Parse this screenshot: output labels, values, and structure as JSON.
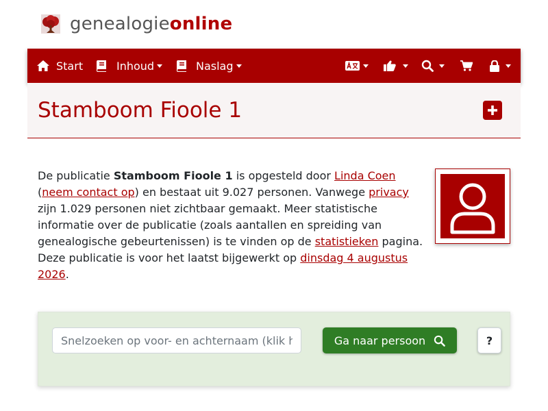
{
  "brand": {
    "part1": "genealogie",
    "part2": "online",
    "icon": "tree-logo-icon"
  },
  "nav": {
    "start": {
      "label": "Start",
      "icon": "home-icon"
    },
    "inhoud": {
      "label": "Inhoud",
      "icon": "book-icon"
    },
    "naslag": {
      "label": "Naslag",
      "icon": "book-icon"
    },
    "right_icons": [
      "language-icon",
      "thumbs-up-icon",
      "search-icon",
      "cart-icon",
      "lock-icon"
    ]
  },
  "page": {
    "title": "Stamboom Fioole 1",
    "add_icon": "plus-square-icon"
  },
  "description": {
    "t1": "De publicatie ",
    "pub_name": "Stamboom Fioole 1",
    "t2": " is opgesteld door ",
    "author": "Linda Coen",
    "t3": " (",
    "contact": "neem contact op",
    "t4": ") en bestaat uit 9.027 personen. Vanwege ",
    "privacy": "privacy",
    "t5": " zijn 1.029 personen niet zichtbaar gemaakt. Meer statistische informatie over de publicatie (zoals aantallen en spreiding van genealogische gebeurtenissen) is te vinden op de ",
    "stats": "statistieken",
    "t6": " pagina. Deze publicatie is voor het laatst bijgewerkt op ",
    "date": "dinsdag 4 augustus 2026",
    "t7": "."
  },
  "avatar": {
    "icon": "user-icon"
  },
  "search": {
    "placeholder": "Snelzoeken op voor- en achternaam (klik hier)",
    "button_label": "Ga naar persoon",
    "button_icon": "search-icon",
    "help_label": "?"
  },
  "colors": {
    "brand_red": "#a80000",
    "search_green": "#2f7d25",
    "panel_green": "#e3eedd"
  }
}
